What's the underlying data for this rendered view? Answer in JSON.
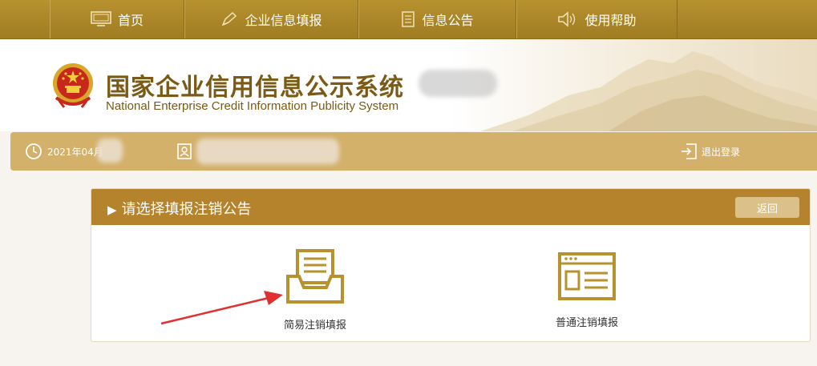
{
  "nav": {
    "items": [
      {
        "label": "首页",
        "icon": "monitor-icon"
      },
      {
        "label": "企业信息填报",
        "icon": "pen-icon"
      },
      {
        "label": "信息公告",
        "icon": "document-icon"
      },
      {
        "label": "使用帮助",
        "icon": "speaker-icon"
      }
    ]
  },
  "header": {
    "title_cn": "国家企业信用信息公示系统",
    "title_en": "National Enterprise Credit Information Publicity System"
  },
  "userbar": {
    "date": "2021年04月",
    "logout": "退出登录"
  },
  "panel": {
    "title": "请选择填报注销公告",
    "back": "返回",
    "options": [
      {
        "label": "简易注销填报",
        "icon": "inbox-document-icon"
      },
      {
        "label": "普通注销填报",
        "icon": "form-window-icon"
      }
    ]
  },
  "colors": {
    "nav_bg": "#b08a2c",
    "userbar_bg": "#d4b16a",
    "panel_head_bg": "#b5832c",
    "icon_gold": "#b8922f",
    "arrow_red": "#e03030"
  }
}
